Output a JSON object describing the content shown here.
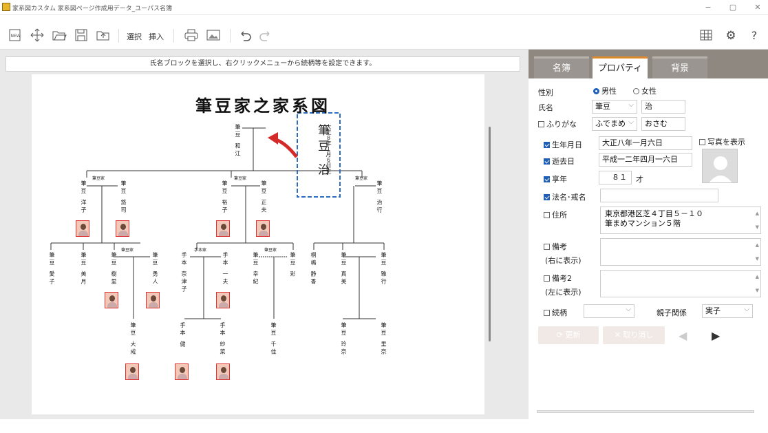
{
  "window": {
    "title": "家系図カスタム 家系図ページ作成用データ_ユーパス名簿",
    "minimize": "−",
    "maximize": "▢",
    "close": "✕"
  },
  "toolbar": {
    "new_label": "NEW",
    "select_label": "選択",
    "insert_label": "挿入"
  },
  "canvas": {
    "hint": "氏名ブロックを選択し、右クリックメニューから続柄等を設定できます。",
    "chart_title": "筆豆家之家系図",
    "selected_person": {
      "birth": "大正８年１月６日生",
      "name": "筆豆 治"
    },
    "persons": [
      {
        "name": "筆豆 和江"
      },
      {
        "name": "筆豆 洋子"
      },
      {
        "name": "筆豆 悠司"
      },
      {
        "name": "筆豆 裕子"
      },
      {
        "name": "筆豆 正夫"
      },
      {
        "name": "筆豆 治行"
      },
      {
        "name": "筆豆 愛子"
      },
      {
        "name": "筆豆 美月"
      },
      {
        "name": "筆豆 樹里"
      },
      {
        "name": "筆豆 勇人"
      },
      {
        "name": "手本 奈津子"
      },
      {
        "name": "手本 一夫"
      },
      {
        "name": "筆豆 幸紀"
      },
      {
        "name": "筆豆 彩"
      },
      {
        "name": "桐嶋 静香"
      },
      {
        "name": "筆豆 真美"
      },
      {
        "name": "筆豆 雅行"
      },
      {
        "name": "筆豆 大成"
      },
      {
        "name": "手本 健"
      },
      {
        "name": "手本 紗菜"
      },
      {
        "name": "筆豆 千佳"
      },
      {
        "name": "筆豆 玲奈"
      },
      {
        "name": "筆豆 里奈"
      }
    ],
    "family_labels": [
      "筆豆家",
      "筆豆家",
      "筆豆家",
      "手本家",
      "筆豆家",
      "筆豆家"
    ]
  },
  "panel": {
    "tabs": [
      {
        "label": "名簿"
      },
      {
        "label": "プロパティ"
      },
      {
        "label": "背景"
      }
    ],
    "gender_label": "性別",
    "gender_male": "男性",
    "gender_female": "女性",
    "name_label": "氏名",
    "surname": "筆豆",
    "given_name": "治",
    "furigana_label": "ふりがな",
    "furigana_surname": "ふでまめ",
    "furigana_given": "おさむ",
    "birth_label": "生年月日",
    "birth_value": "大正八年一月六日",
    "photo_label": "写真を表示",
    "death_label": "逝去日",
    "death_value": "平成一二年四月一六日",
    "age_label": "享年",
    "age_value": "８１",
    "age_unit": "才",
    "dharma_label": "法名･戒名",
    "dharma_value": "",
    "address_label": "住所",
    "address_line1": "東京都港区芝４丁目５－１０",
    "address_line2": "筆まめマンション５階",
    "note_label": "備考",
    "note_sub": "(右に表示)",
    "note2_label": "備考2",
    "note2_sub": "(左に表示)",
    "relation_label": "続柄",
    "relation_value": "",
    "parent_rel_label": "親子関係",
    "parent_rel_value": "実子",
    "update_button": "更新",
    "cancel_button": "取り消し",
    "prev_arrow": "◀",
    "next_arrow": "▶"
  }
}
